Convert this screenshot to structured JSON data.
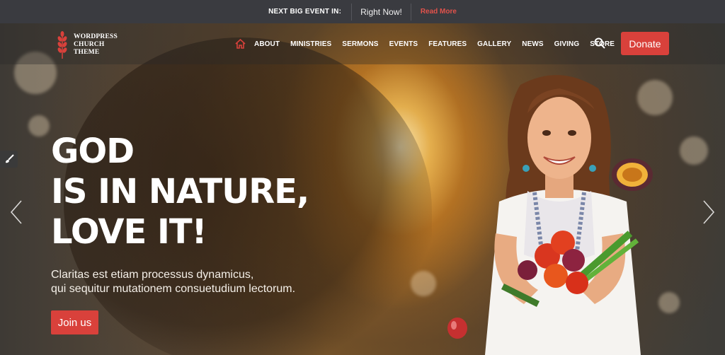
{
  "topbar": {
    "label": "NEXT BIG EVENT IN:",
    "countdown": "Right Now!",
    "more": "Read More"
  },
  "logo": {
    "line1": "WORDPRESS",
    "line2": "CHURCH",
    "line3": "THEME",
    "icon": "wheat-icon"
  },
  "nav": {
    "items": [
      "ABOUT",
      "MINISTRIES",
      "SERMONS",
      "EVENTS",
      "FEATURES",
      "GALLERY",
      "NEWS",
      "GIVING",
      "STORE"
    ],
    "donate": "Donate"
  },
  "hero": {
    "headline": [
      "GOD",
      "IS IN NATURE,",
      "LOVE IT!"
    ],
    "subtext": [
      "Claritas est etiam processus dynamicus,",
      "qui sequitur mutationem consuetudium lectorum."
    ],
    "cta": "Join us"
  },
  "colors": {
    "accent": "#d9413b",
    "topbar": "#3a3b40",
    "read_more": "#e2524b"
  }
}
